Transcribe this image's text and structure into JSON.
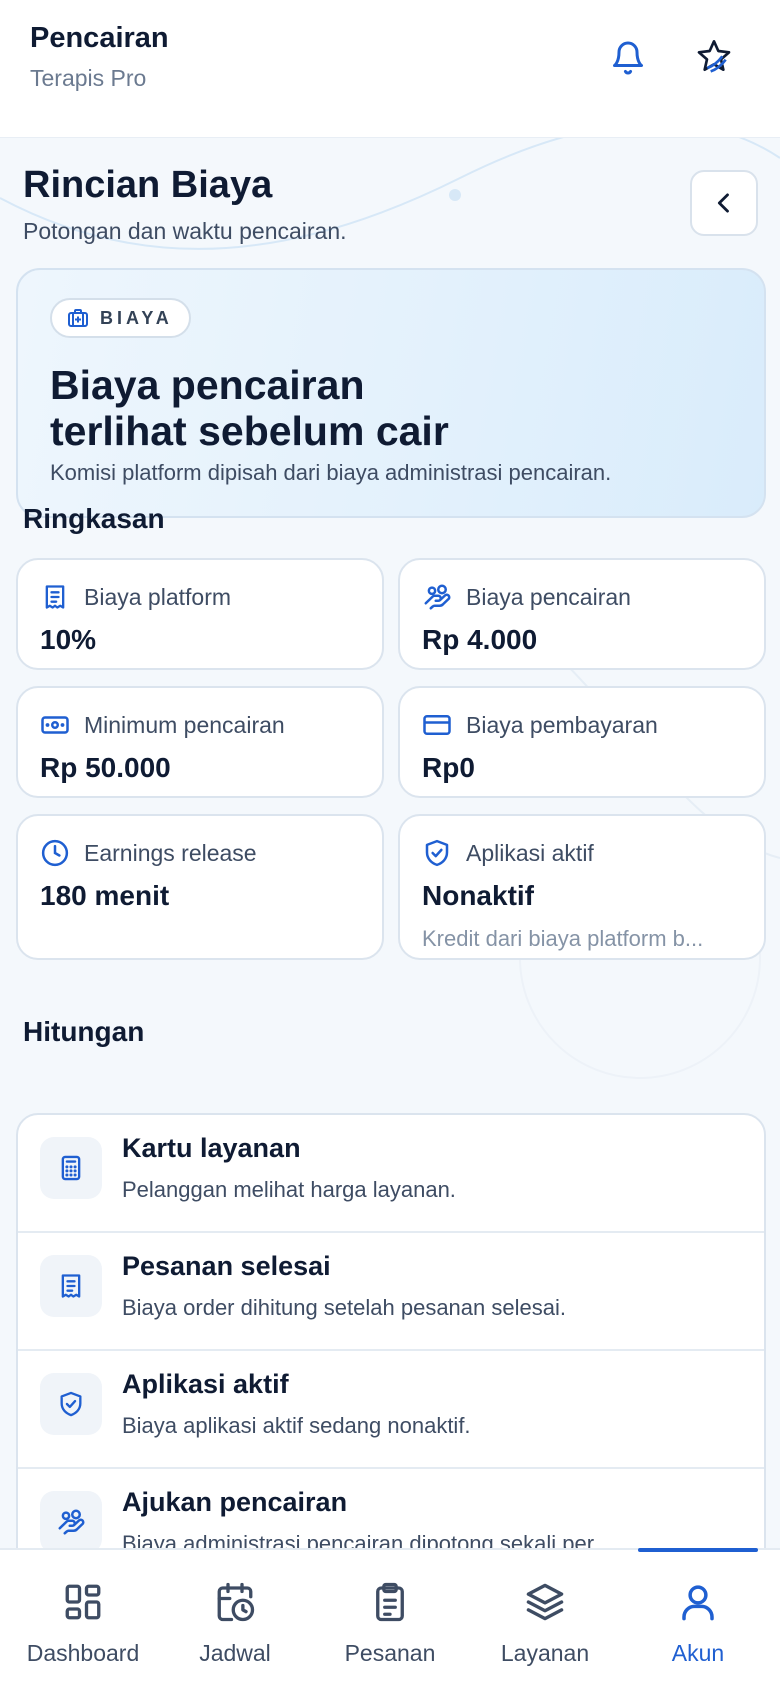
{
  "header": {
    "title": "Pencairan",
    "subtitle": "Terapis Pro"
  },
  "page": {
    "title": "Rincian Biaya",
    "subtitle": "Potongan dan waktu pencairan."
  },
  "hero": {
    "badge": "BIAYA",
    "title_line1": "Biaya pencairan",
    "title_line2": "terlihat sebelum cair",
    "description": "Komisi platform dipisah dari biaya administrasi pencairan."
  },
  "summary": {
    "title": "Ringkasan",
    "cards": [
      {
        "label": "Biaya platform",
        "value": "10%",
        "icon": "receipt-icon"
      },
      {
        "label": "Biaya pencairan",
        "value": "Rp 4.000",
        "icon": "hand-coins-icon"
      },
      {
        "label": "Minimum pencairan",
        "value": "Rp 50.000",
        "icon": "banknote-icon"
      },
      {
        "label": "Biaya pembayaran",
        "value": "Rp0",
        "icon": "credit-card-icon"
      },
      {
        "label": "Earnings release",
        "value": "180 menit",
        "icon": "clock-icon"
      },
      {
        "label": "Aplikasi aktif",
        "value": "Nonaktif",
        "note": "Kredit dari biaya platform b...",
        "icon": "shield-check-icon"
      }
    ]
  },
  "calculation": {
    "title": "Hitungan",
    "rows": [
      {
        "title": "Kartu layanan",
        "description": "Pelanggan melihat harga layanan.",
        "icon": "calculator-icon"
      },
      {
        "title": "Pesanan selesai",
        "description": "Biaya order dihitung setelah pesanan selesai.",
        "icon": "receipt-icon"
      },
      {
        "title": "Aplikasi aktif",
        "description": "Biaya aplikasi aktif sedang nonaktif.",
        "icon": "shield-check-icon"
      },
      {
        "title": "Ajukan pencairan",
        "description": "Biaya administrasi pencairan dipotong sekali per",
        "icon": "hand-coins-icon"
      }
    ]
  },
  "nav": {
    "items": [
      {
        "label": "Dashboard",
        "icon": "grid-icon"
      },
      {
        "label": "Jadwal",
        "icon": "calendar-clock-icon"
      },
      {
        "label": "Pesanan",
        "icon": "clipboard-icon"
      },
      {
        "label": "Layanan",
        "icon": "layers-icon"
      },
      {
        "label": "Akun",
        "icon": "user-icon",
        "active": true
      }
    ]
  },
  "colors": {
    "accent": "#1f5fd1",
    "text": "#0f1b33",
    "muted": "#3e4c63",
    "background": "#f4f8fc"
  }
}
